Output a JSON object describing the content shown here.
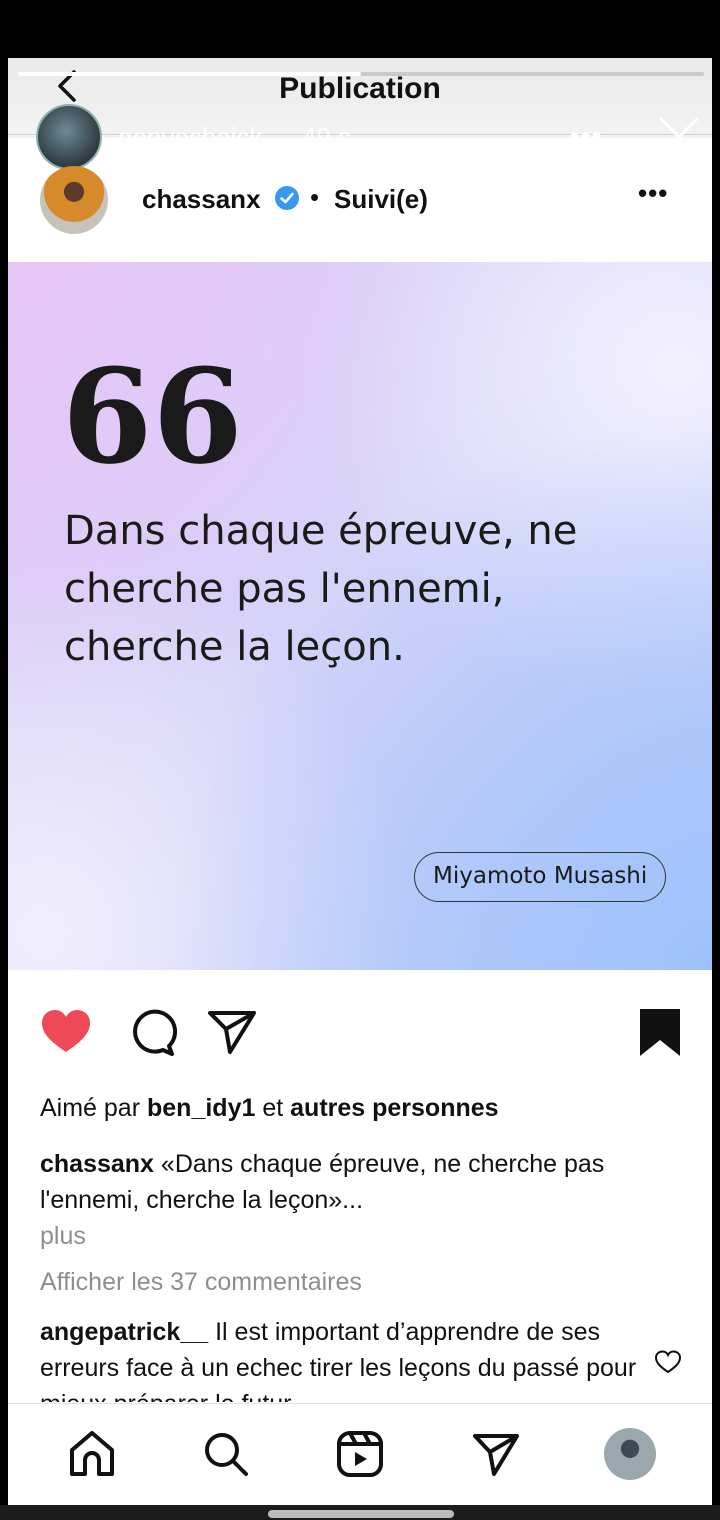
{
  "header": {
    "title": "Publication",
    "story_user": "gonyecheick",
    "story_time": "49 s",
    "story_more": "•••"
  },
  "post": {
    "username": "chassanx",
    "separator": "•",
    "follow_status": "Suivi(e)",
    "more": "•••"
  },
  "image": {
    "quote_mark": "66",
    "quote_text": "Dans chaque épreuve, ne cherche pas l'ennemi, cherche la leçon.",
    "author": "Miyamoto Musashi"
  },
  "likes": {
    "prefix": "Aimé par",
    "user": "ben_idy1",
    "middle": "et",
    "others": "autres personnes"
  },
  "caption": {
    "user": "chassanx",
    "text": "«Dans chaque épreuve, ne cherche pas l'ennemi, cherche la leçon»...",
    "more": "plus"
  },
  "comments": {
    "view_all": "Afficher les 37 commentaires",
    "first_user": "angepatrick__",
    "first_text": "Il est important d’apprendre de ses erreurs face à un echec tirer les leçons du passé pour mieux préparer le futur..."
  },
  "colors": {
    "like_red": "#ed4956",
    "verified_blue": "#3897f0"
  },
  "icons": [
    "back-icon",
    "close-icon",
    "verified-icon",
    "heart-icon",
    "comment-icon",
    "share-icon",
    "bookmark-icon",
    "home-icon",
    "search-icon",
    "reels-icon",
    "send-icon"
  ]
}
